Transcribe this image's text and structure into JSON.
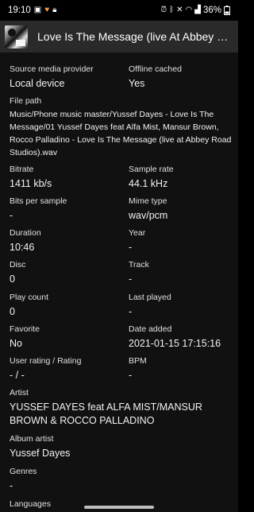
{
  "status_bar": {
    "time": "19:10",
    "battery": "36%",
    "left_icons": [
      "photo-icon",
      "heart-icon",
      "lock-icon"
    ],
    "right_icons": [
      "alarm-icon",
      "bluetooth-icon",
      "mute-icon",
      "wifi-icon",
      "signal-icon",
      "battery-icon"
    ]
  },
  "header": {
    "title": "Love Is The Message (live At Abbey Road Studios)"
  },
  "fields": {
    "source": {
      "label": "Source media provider",
      "value": "Local device"
    },
    "offline": {
      "label": "Offline cached",
      "value": "Yes"
    },
    "file_path": {
      "label": "File path",
      "value": "Music/Phone music master/Yussef Dayes - Love Is The Message/01 Yussef Dayes feat Alfa Mist, Mansur Brown, Rocco Palladino - Love Is The Message (live at Abbey Road Studios).wav"
    },
    "bitrate": {
      "label": "Bitrate",
      "value": "1411 kb/s"
    },
    "sample_rate": {
      "label": "Sample rate",
      "value": "44.1 kHz"
    },
    "bits_per_sample": {
      "label": "Bits per sample",
      "value": "-"
    },
    "mime_type": {
      "label": "Mime type",
      "value": "wav/pcm"
    },
    "duration": {
      "label": "Duration",
      "value": "10:46"
    },
    "year": {
      "label": "Year",
      "value": "-"
    },
    "disc": {
      "label": "Disc",
      "value": "0"
    },
    "track": {
      "label": "Track",
      "value": "-"
    },
    "play_count": {
      "label": "Play count",
      "value": "0"
    },
    "last_played": {
      "label": "Last played",
      "value": "-"
    },
    "favorite": {
      "label": "Favorite",
      "value": "No"
    },
    "date_added": {
      "label": "Date added",
      "value": "2021-01-15 17:15:16"
    },
    "rating": {
      "label": "User rating / Rating",
      "value": "- / -"
    },
    "bpm": {
      "label": "BPM",
      "value": "-"
    },
    "artist": {
      "label": "Artist",
      "value": "YUSSEF DAYES feat ALFA MIST/MANSUR BROWN & ROCCO PALLADINO"
    },
    "album_artist": {
      "label": "Album artist",
      "value": "Yussef Dayes"
    },
    "genres": {
      "label": "Genres",
      "value": "-"
    },
    "languages": {
      "label": "Languages",
      "value": ""
    }
  }
}
